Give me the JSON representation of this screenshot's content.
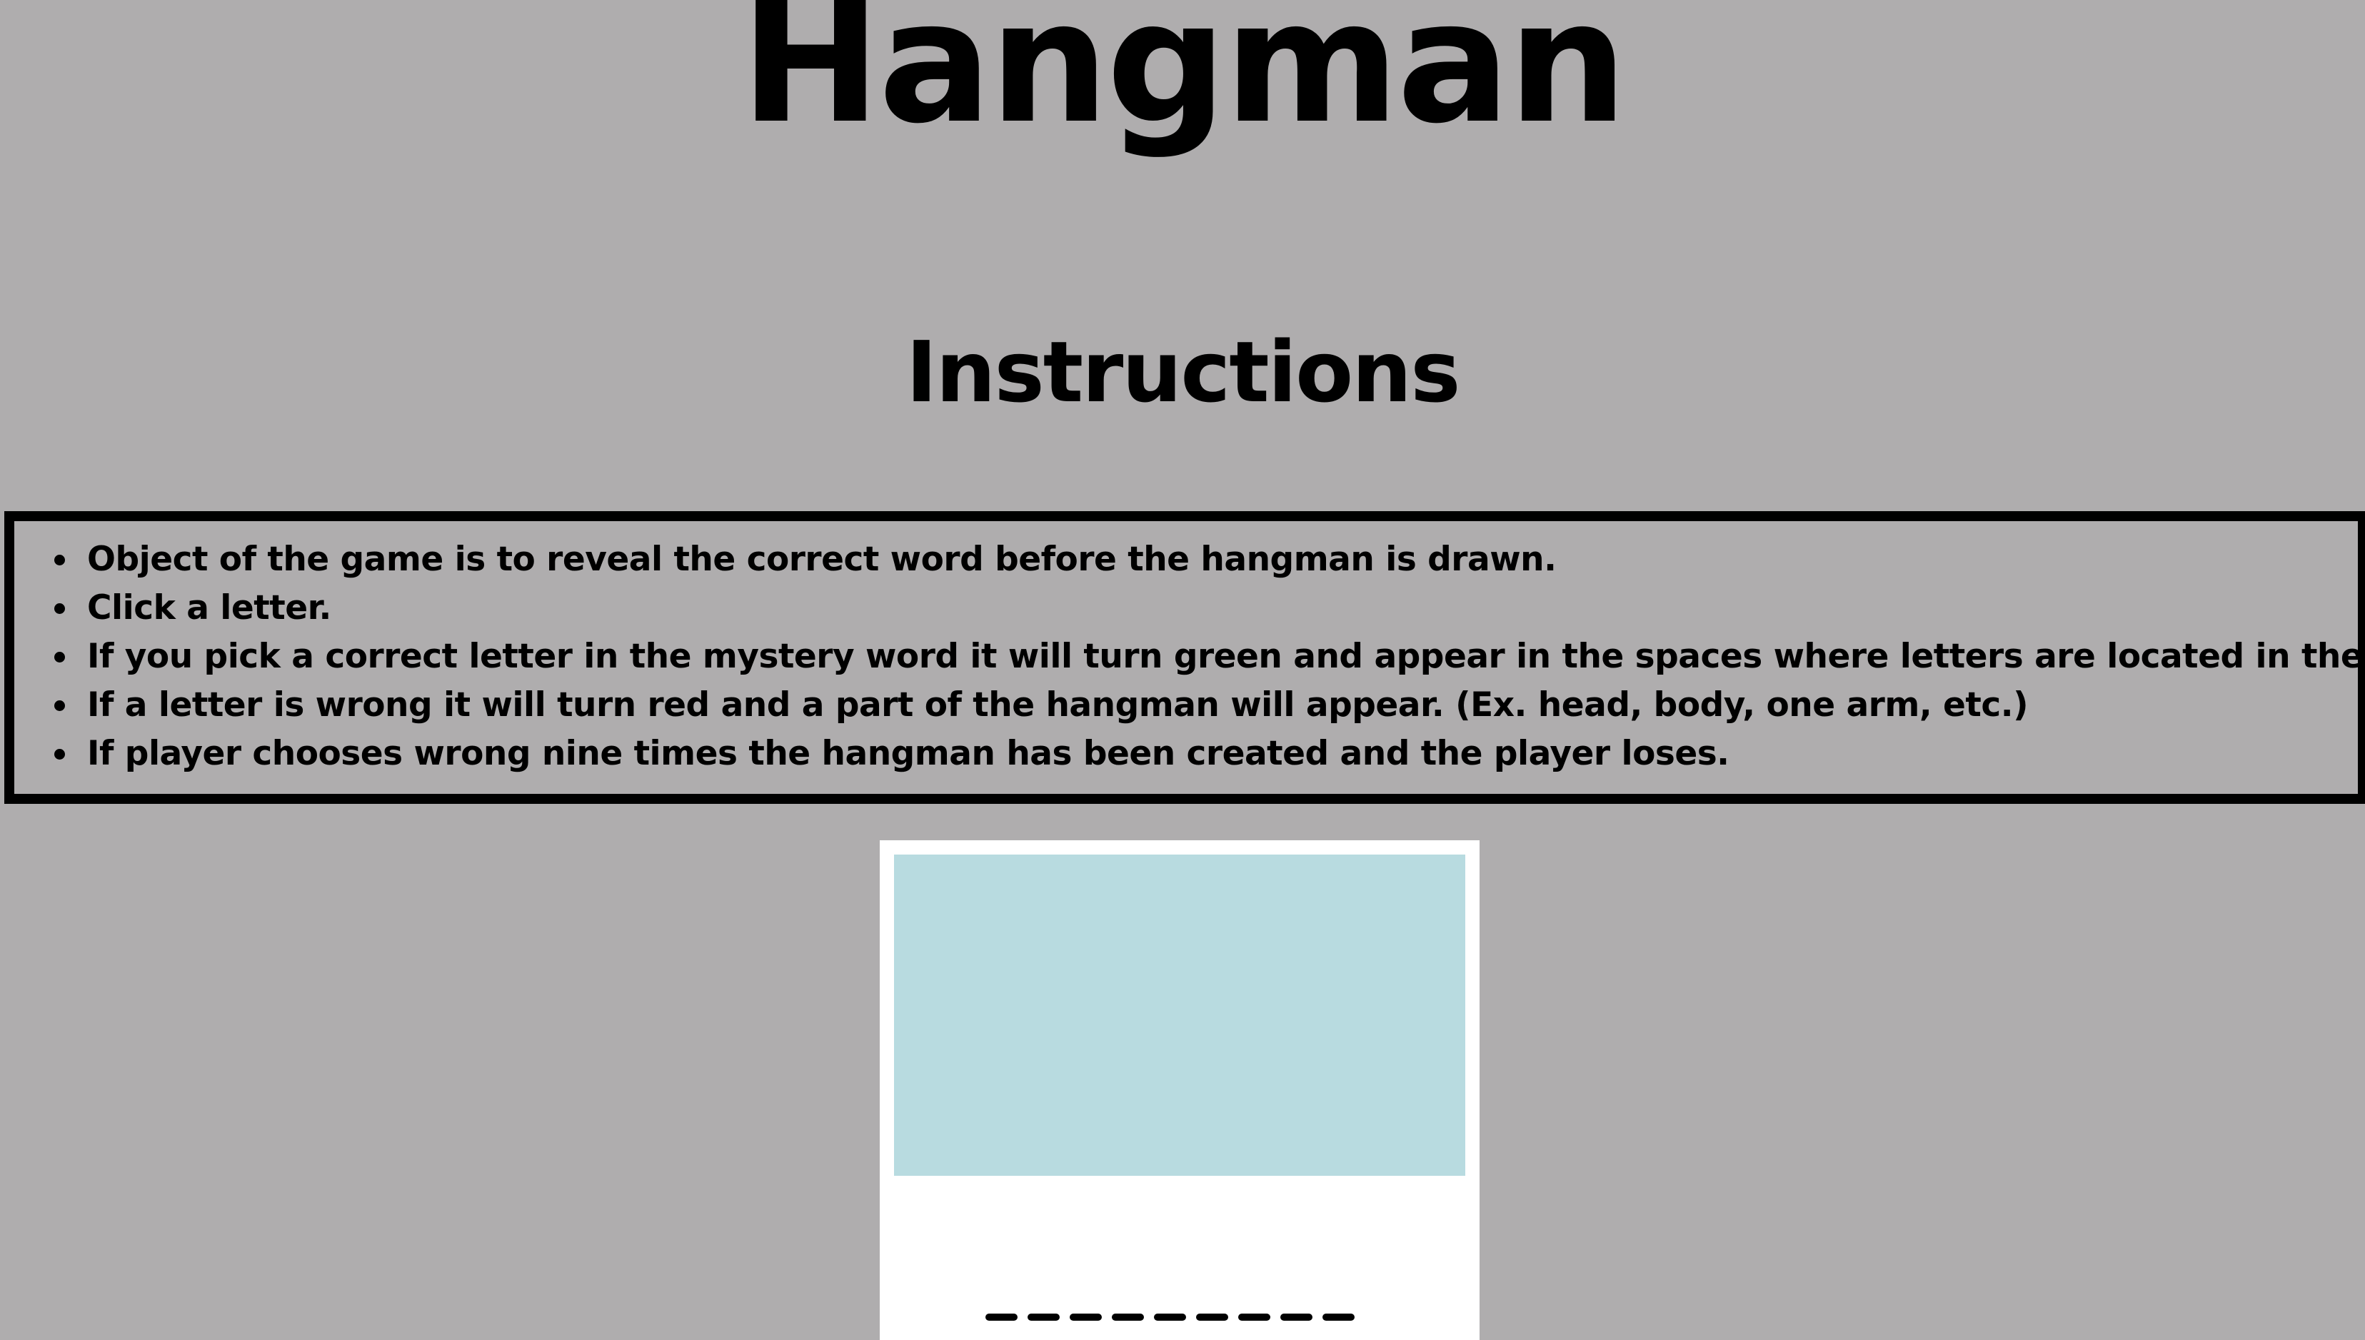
{
  "header": {
    "title": "Hangman"
  },
  "instructions": {
    "heading": "Instructions",
    "items": [
      "Object of the game is to reveal the correct word before the hangman is drawn.",
      "Click a letter.",
      "If you pick a correct letter in the mystery word it will turn green and appear in the spaces where letters are located in the word.",
      "If a letter is wrong it will turn red and a part of the hangman will appear. (Ex. head, body, one arm, etc.)",
      "If player chooses wrong nine times the hangman has been created and the player loses."
    ]
  },
  "game": {
    "canvas_color": "#b8dbe0",
    "panel_color": "#ffffff",
    "word_length": 9,
    "revealed": "_________"
  },
  "colors": {
    "background": "#afadae",
    "text": "#000000"
  }
}
